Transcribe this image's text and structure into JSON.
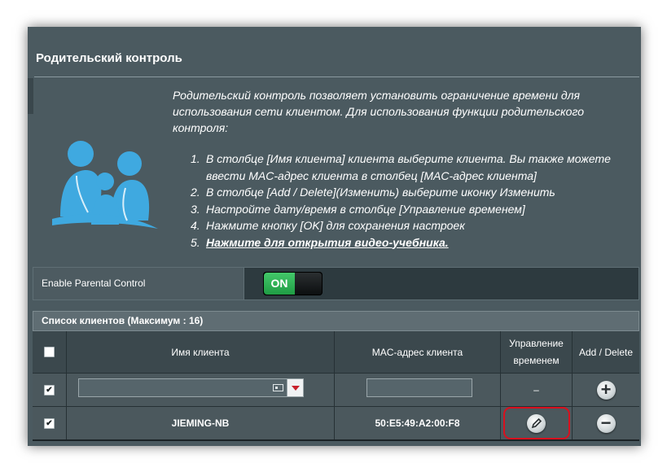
{
  "section": {
    "title": "Родительский контроль",
    "intro": "Родительский контроль позволяет установить ограничение времени для использования сети клиентом. Для использования функции родительского контроля:",
    "steps": [
      {
        "num": "1.",
        "text": "В столбце [Имя клиента] клиента выберите клиента. Вы также можете ввести MAC-адрес клиента в столбец [MAC-адрес клиента]"
      },
      {
        "num": "2.",
        "text": "В столбце [Add / Delete](Изменить) выберите иконку Изменить"
      },
      {
        "num": "3.",
        "text": "Настройте дату/время в столбце [Управление временем]"
      },
      {
        "num": "4.",
        "text": "Нажмите кнопку [OK] для сохранения настроек"
      },
      {
        "num": "5.",
        "text": "Нажмите для открытия видео-учебника."
      }
    ],
    "logo_icon": "family-icon"
  },
  "enable": {
    "label": "Enable Parental Control",
    "toggle_state": "ON"
  },
  "client_list": {
    "title": "Список клиентов (Максимум : 16)",
    "columns": {
      "name": "Имя клиента",
      "mac": "MAC-адрес клиента",
      "time_line1": "Управление",
      "time_line2": "временем",
      "add_delete": "Add / Delete"
    },
    "input_row": {
      "name_value": "",
      "mac_value": "",
      "time": "–",
      "action_icon": "plus-circle-icon",
      "checked": true
    },
    "rows": [
      {
        "name": "JIEMING-NB",
        "mac": "50:E5:49:A2:00:F8",
        "time_icon": "pencil-icon",
        "action_icon": "minus-circle-icon",
        "checked": true
      }
    ]
  },
  "colors": {
    "panel_bg": "#4b5a60",
    "toggle_on": "#2fb356",
    "highlight": "#d9101e"
  }
}
